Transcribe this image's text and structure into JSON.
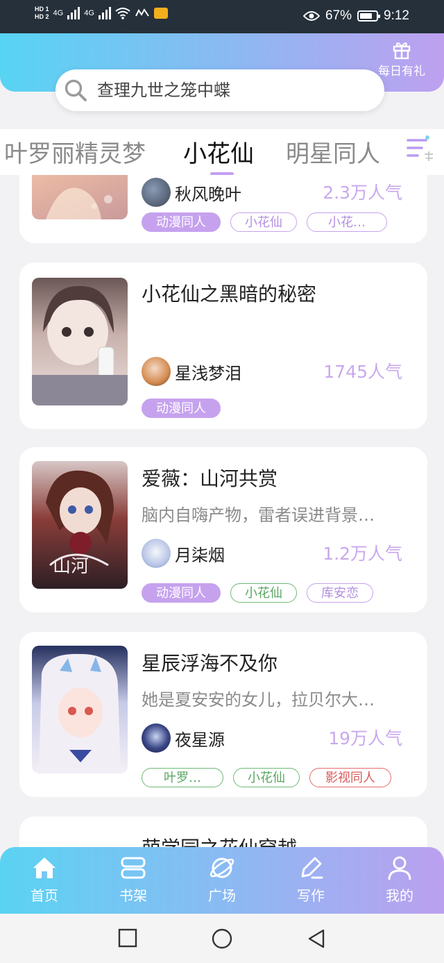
{
  "status_bar": {
    "hd1": "HD 1",
    "hd2": "HD 2",
    "net1": "4G",
    "net2": "4G",
    "battery_percent": "67%",
    "time": "9:12"
  },
  "header": {
    "daily_gift_label": "每日有礼",
    "search_placeholder": "查理九世之笼中蝶"
  },
  "tabs": [
    {
      "label": "叶罗丽精灵梦"
    },
    {
      "label": "小花仙"
    },
    {
      "label": "明星同人"
    }
  ],
  "cards": [
    {
      "author": "秋风晚叶",
      "popularity": "2.3万人气",
      "tags": [
        "动漫同人",
        "小花仙",
        "小花…"
      ]
    },
    {
      "title": "小花仙之黑暗的秘密",
      "author": "星浅梦泪",
      "popularity": "1745人气",
      "tags": [
        "动漫同人"
      ]
    },
    {
      "title": "爱薇：山河共赏",
      "desc": "脑内自嗨产物，雷者误进背景…",
      "author": "月柒烟",
      "popularity": "1.2万人气",
      "tags": [
        "动漫同人",
        "小花仙",
        "库安恋"
      ]
    },
    {
      "title": "星辰浮海不及你",
      "desc": "她是夏安安的女儿，拉贝尔大…",
      "author": "夜星源",
      "popularity": "19万人气",
      "tags": [
        "叶罗…",
        "小花仙",
        "影视同人"
      ]
    },
    {
      "title": "萌学园之花仙穿越"
    }
  ],
  "bottom_nav": [
    {
      "label": "首页",
      "icon": "home-icon"
    },
    {
      "label": "书架",
      "icon": "bookshelf-icon"
    },
    {
      "label": "广场",
      "icon": "planet-icon"
    },
    {
      "label": "写作",
      "icon": "pen-icon"
    },
    {
      "label": "我的",
      "icon": "user-icon"
    }
  ],
  "colors": {
    "accent_purple": "#c6a2ee",
    "header_gradient_start": "#57d4f3",
    "header_gradient_end": "#bea0ef",
    "tag_green": "#6dba74",
    "tag_red": "#e46e6e"
  }
}
